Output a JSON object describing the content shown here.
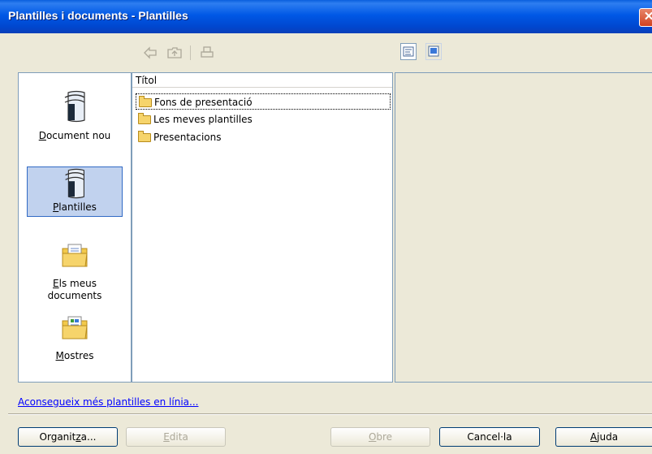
{
  "window": {
    "title": "Plantilles i documents - Plantilles",
    "close_glyph": "✕"
  },
  "toolbar": {
    "icons": [
      "back-arrow-icon",
      "up-folder-icon",
      "print-icon"
    ],
    "view_buttons": [
      "details-view-icon",
      "preview-view-icon"
    ]
  },
  "nav": {
    "items": [
      {
        "label": "Document nou",
        "access_key": "D",
        "rest": "ocument nou",
        "icon": "new-document-icon",
        "selected": false
      },
      {
        "label": "Plantilles",
        "access_key": "P",
        "rest": "lantilles",
        "icon": "templates-icon",
        "selected": true
      },
      {
        "label": "Els meus documents",
        "line1_key": "E",
        "line1_rest": "ls meus",
        "line2": "documents",
        "icon": "my-documents-icon",
        "selected": false
      },
      {
        "label": "Mostres",
        "access_key": "M",
        "rest": "ostres",
        "icon": "samples-icon",
        "selected": false
      }
    ]
  },
  "list": {
    "column_header": "Títol",
    "rows": [
      "Fons de presentació",
      "Les meves plantilles",
      "Presentacions"
    ]
  },
  "link": "Aconsegueix més plantilles en línia...",
  "buttons": {
    "organize": {
      "pre": "Organit",
      "key": "z",
      "post": "a..."
    },
    "edit": {
      "key": "E",
      "rest": "dita"
    },
    "open": {
      "key": "O",
      "rest": "bre"
    },
    "cancel": "Cancel·la",
    "help": {
      "key": "A",
      "rest": "juda"
    }
  },
  "colors": {
    "title_bar": "#0058e6",
    "selection": "#c1d2ee",
    "link": "#0000ff",
    "folder": "#f6d46b"
  }
}
